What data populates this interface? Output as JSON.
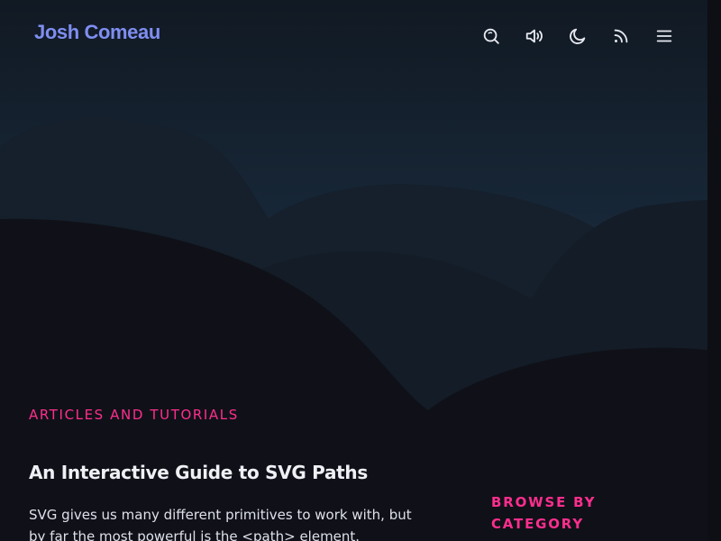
{
  "header": {
    "logo": "Josh Comeau",
    "icons": [
      "search-icon",
      "volume-icon",
      "moon-icon",
      "rss-icon",
      "menu-icon"
    ]
  },
  "colors": {
    "background": "#101118",
    "accent": "#ff2e8e",
    "logo": "#7f8ef0",
    "text": "#eef0f6"
  },
  "main": {
    "eyebrow": "ARTICLES AND TUTORIALS",
    "article": {
      "title": "An Interactive Guide to SVG Paths",
      "excerpt": "SVG gives us many different primitives to work with, but by far the most powerful is the <path> element."
    }
  },
  "sidebar": {
    "heading": "BROWSE BY CATEGORY"
  }
}
